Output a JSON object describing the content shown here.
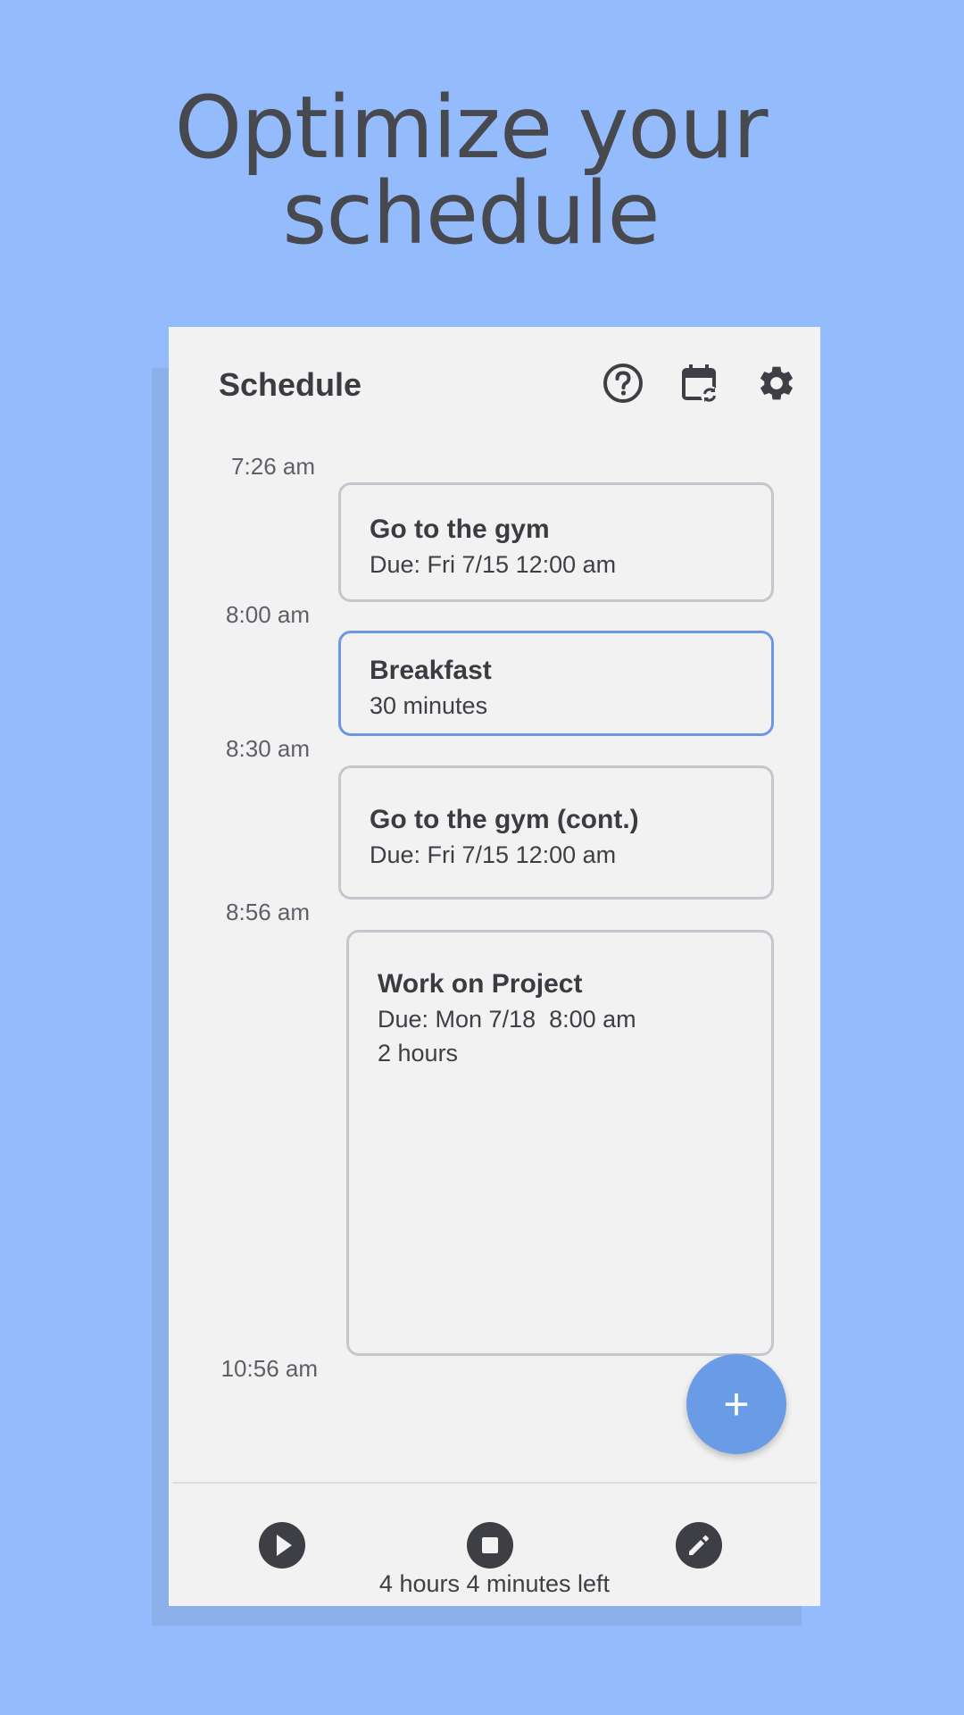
{
  "headline": {
    "line1": "Optimize your",
    "line2": "schedule"
  },
  "appbar": {
    "title": "Schedule",
    "icons": [
      "help-icon",
      "calendar-sync-icon",
      "settings-gear-icon"
    ]
  },
  "timeline": {
    "times": [
      "7:26 am",
      "8:00 am",
      "8:30 am",
      "8:56 am",
      "10:56 am"
    ],
    "events": [
      {
        "title": "Go to the gym",
        "lines": [
          "Due: Fri 7/15 12:00 am"
        ]
      },
      {
        "title": "Breakfast",
        "lines": [
          "30 minutes"
        ]
      },
      {
        "title": "Go to the gym (cont.)",
        "lines": [
          "Due: Fri 7/15 12:00 am"
        ]
      },
      {
        "title": "Work on Project",
        "lines": [
          "Due: Mon 7/18  8:00 am",
          "2 hours"
        ]
      }
    ]
  },
  "fab": {
    "label": "+"
  },
  "bottom_bar": {
    "icons": [
      "play-icon",
      "stop-icon",
      "edit-pencil-icon"
    ],
    "remaining": "4 hours 4 minutes left"
  },
  "colors": {
    "background": "#94bbfc",
    "accent": "#6a9be6",
    "selected_border": "#6d97e6",
    "card_border": "#c4c8ce"
  }
}
